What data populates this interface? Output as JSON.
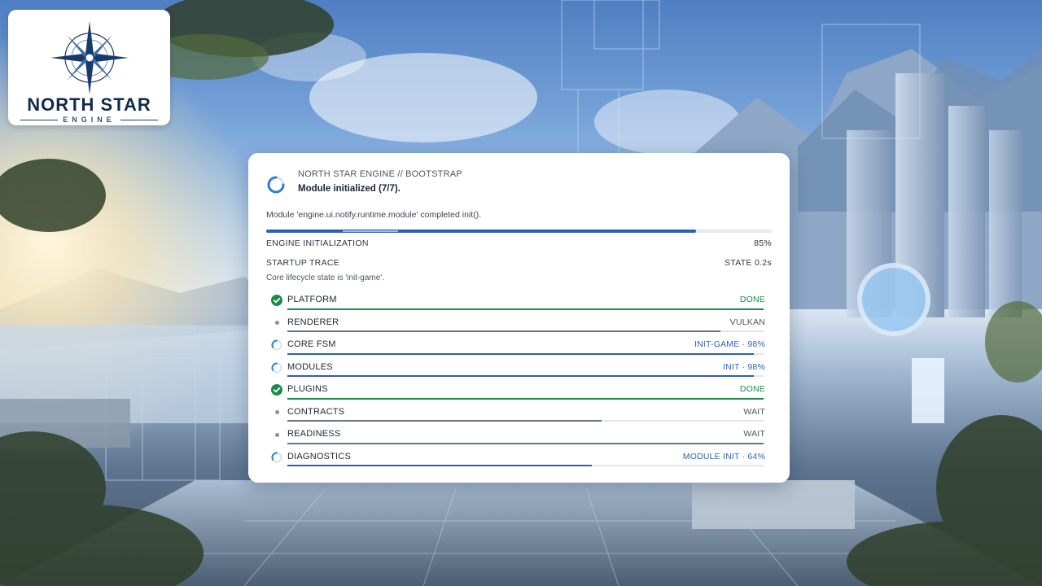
{
  "logo": {
    "title": "NORTH STAR",
    "subtitle": "ENGINE"
  },
  "panel": {
    "kicker": "NORTH STAR ENGINE // BOOTSTRAP",
    "title": "Module initialized (7/7).",
    "detail": "Module 'engine.ui.notify.runtime.module' completed init().",
    "engine_init_label": "ENGINE INITIALIZATION",
    "engine_init_value": "85%",
    "engine_init_progress": 0.85,
    "trace_label": "STARTUP TRACE",
    "trace_value": "STATE 0.2s",
    "trace_note": "Core lifecycle state is 'init-game'."
  },
  "steps": [
    {
      "name": "PLATFORM",
      "status": "DONE",
      "state": "done",
      "progress": 1.0
    },
    {
      "name": "RENDERER",
      "status": "VULKAN",
      "state": "idle",
      "progress": 0.91
    },
    {
      "name": "CORE FSM",
      "status": "INIT-GAME · 98%",
      "state": "active",
      "progress": 0.98
    },
    {
      "name": "MODULES",
      "status": "INIT · 98%",
      "state": "active",
      "progress": 0.98
    },
    {
      "name": "PLUGINS",
      "status": "DONE",
      "state": "done",
      "progress": 1.0
    },
    {
      "name": "CONTRACTS",
      "status": "WAIT",
      "state": "idle",
      "progress": 0.66
    },
    {
      "name": "READINESS",
      "status": "WAIT",
      "state": "idle",
      "progress": 1.0
    },
    {
      "name": "DIAGNOSTICS",
      "status": "MODULE INIT · 64%",
      "state": "active",
      "progress": 0.64
    }
  ],
  "colors": {
    "accent": "#2e5fb8",
    "done": "#1f8a4c",
    "idle_bar": "#6b7480"
  },
  "icons": {
    "done": "check-circle-icon",
    "active": "spinner-icon",
    "idle": "dot-icon"
  }
}
